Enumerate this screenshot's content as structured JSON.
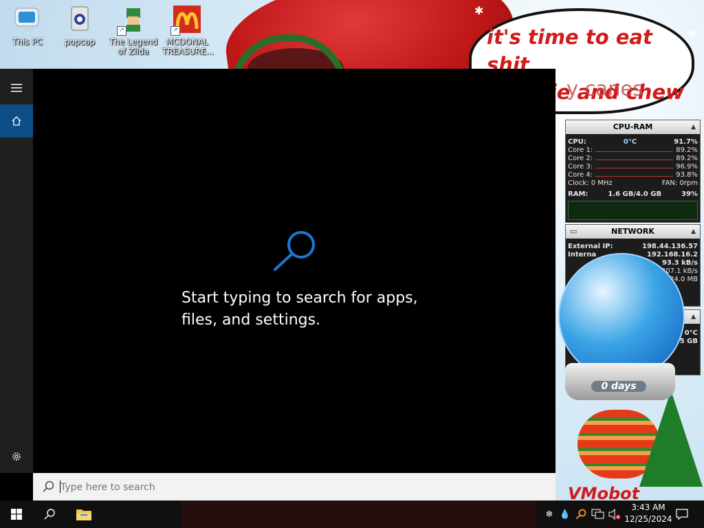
{
  "desktop": {
    "icons": [
      {
        "label": "This PC",
        "icon": "this-pc-icon"
      },
      {
        "label": "popcap",
        "icon": "popcap-icon"
      },
      {
        "label": "The Legend of Zilda",
        "icon": "zilda-game-icon"
      },
      {
        "label": "MCDONAL TREASURE...",
        "icon": "mcdonalds-icon"
      }
    ],
    "wallpaper": {
      "bubble_text": "it's time to eat shit\nand die and chew",
      "bubble_tail": "y canes",
      "globe_label": "0 days",
      "signature": "VMobot"
    }
  },
  "gadgets": {
    "cpu": {
      "title": "CPU-RAM",
      "cpu_label": "CPU:",
      "cpu_temp": "0°C",
      "cpu_value": "91.7%",
      "cores": [
        {
          "label": "Core 1:",
          "value": "89.2%"
        },
        {
          "label": "Core 2:",
          "value": "89.2%"
        },
        {
          "label": "Core 3:",
          "value": "96.9%"
        },
        {
          "label": "Core 4:",
          "value": "93.8%"
        }
      ],
      "clock_label": "Clock: 0 MHz",
      "fan_label": "FAN: 0rpm",
      "ram_label": "RAM:",
      "ram_value": "1.6 GB/4.0 GB",
      "ram_pct": "39%"
    },
    "network": {
      "title": "NETWORK",
      "external_label": "External IP:",
      "external_value": "198.44.136.57",
      "internal_label": "Interna",
      "internal_value": "192.168.16.2",
      "down_value": "93.3 kB/s",
      "up_value": "207.1 kB/s",
      "total_value": "24.0 MB"
    },
    "extra": {
      "temp": "0°C",
      "size": "9.5 GB"
    }
  },
  "start": {
    "hint": "Start typing to search for apps,\nfiles, and settings.",
    "search_placeholder": "Type here to search"
  },
  "taskbar": {
    "time": "3:43 AM",
    "date": "12/25/2024"
  },
  "colors": {
    "accent": "#0e4e87",
    "magnifier": "#1c78d4"
  }
}
